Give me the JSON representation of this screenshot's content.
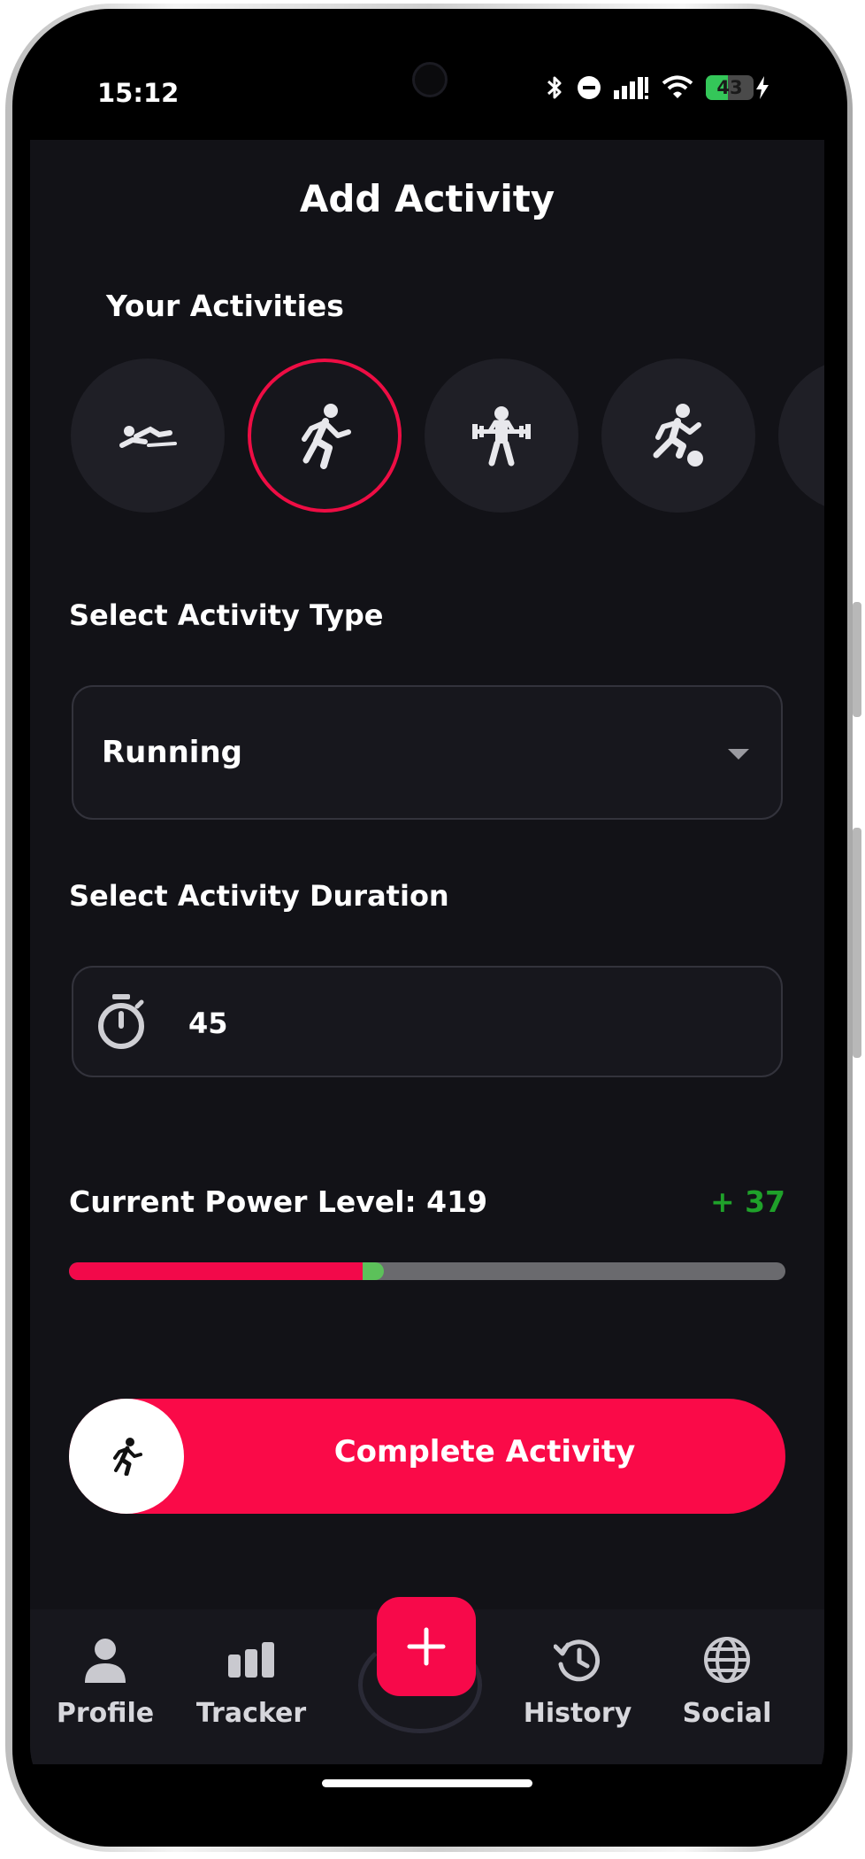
{
  "status_bar": {
    "time": "15:12",
    "battery": "43"
  },
  "page": {
    "title": "Add Activity"
  },
  "activities": {
    "section_title": "Your Activities",
    "items": [
      {
        "icon": "swimming-icon",
        "selected": false
      },
      {
        "icon": "running-icon",
        "selected": true
      },
      {
        "icon": "weightlifting-icon",
        "selected": false
      },
      {
        "icon": "soccer-icon",
        "selected": false
      }
    ]
  },
  "activity_type": {
    "label": "Select Activity Type",
    "value": "Running"
  },
  "duration": {
    "label": "Select Activity Duration",
    "value": "45"
  },
  "power": {
    "label": "Current Power Level: 419",
    "gain": "+ 37",
    "level_fraction": 0.41,
    "gain_fraction": 0.03,
    "colors": {
      "base": "#f2094a",
      "gain": "#5cc15a",
      "track": "#6a6a6e"
    }
  },
  "complete_button": {
    "label": "Complete Activity"
  },
  "tabbar": {
    "items": [
      {
        "label": "Profile",
        "icon": "person-icon"
      },
      {
        "label": "Tracker",
        "icon": "bar-chart-icon"
      },
      {
        "label": "History",
        "icon": "history-icon"
      },
      {
        "label": "Social",
        "icon": "globe-icon"
      }
    ],
    "fab_icon": "plus-icon"
  },
  "colors": {
    "accent": "#fa0a48",
    "background": "#121217",
    "positive": "#1fa12a"
  }
}
